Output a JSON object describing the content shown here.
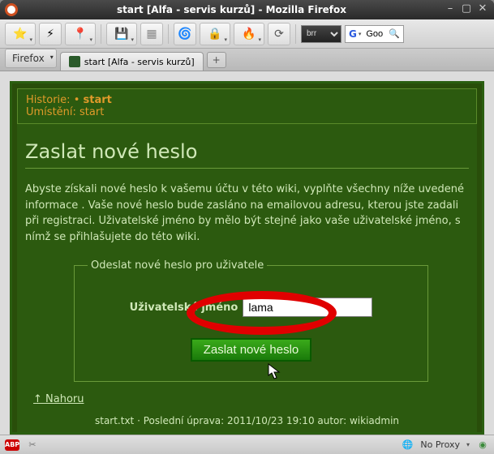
{
  "window": {
    "title": "start [Alfa - servis kurzů] - Mozilla Firefox"
  },
  "toolbar": {
    "selector_value": "brr",
    "search_value": "Goo"
  },
  "tabs": {
    "firefox_menu": "Firefox",
    "active": "start [Alfa - servis kurzů]"
  },
  "page": {
    "history_label": "Historie:",
    "history_current": "start",
    "location_label": "Umístění:",
    "location_value": "start",
    "heading": "Zaslat nové heslo",
    "instructions": "Abyste získali nové heslo k vašemu účtu v této wiki, vyplňte všechny níže uvedené informace . Vaše nové heslo bude zasláno na emailovou adresu, kterou jste zadali při registraci. Uživatelské jméno by mělo být stejné jako vaše uživatelské jméno, s nímž se přihlašujete do této wiki.",
    "fieldset_legend": "Odeslat nové heslo pro uživatele",
    "username_label": "Uživatelské jméno",
    "username_value": "lama",
    "submit_label": "Zaslat nové heslo",
    "back_top": "↑ Nahoru",
    "footer": "start.txt · Poslední úprava: 2011/10/23 19:10 autor: wikiadmin"
  },
  "statusbar": {
    "proxy": "No Proxy"
  }
}
